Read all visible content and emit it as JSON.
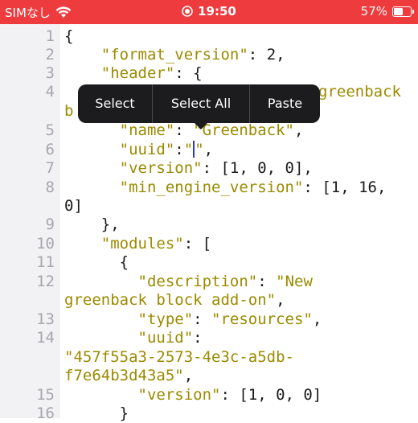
{
  "status_bar": {
    "carrier": "SIMなし",
    "time": "19:50",
    "battery": "57%",
    "battery_level": 0.57
  },
  "context_menu": {
    "items": [
      "Select",
      "Select All",
      "Paste"
    ]
  },
  "editor": {
    "line_numbers": [
      "1",
      "2",
      "3",
      "4",
      "5",
      "6",
      "7",
      "8",
      "9",
      "10",
      "11",
      "12",
      "13",
      "14",
      "15",
      "16"
    ],
    "code": {
      "l1": "{",
      "l2_key": "\"format_version\"",
      "l2_val": "2,",
      "l3_key": "\"header\"",
      "l3_rest": "{",
      "l4_visible": "greenback",
      "l4_wrap": "b",
      "l5_key": "\"name\"",
      "l5_val": "\"Greenback\"",
      "l6_key": "\"uuid\"",
      "l6_open": "\"",
      "l6_close": "\"",
      "l7_key": "\"version\"",
      "l7_val": "[1, 0, 0],",
      "l8_key": "\"min_engine_version\"",
      "l8_val": "[1, 16,",
      "l8_wrap": "0]",
      "l9": "},",
      "l10_key": "\"modules\"",
      "l10_val": "[",
      "l11": "{",
      "l12_key": "\"description\"",
      "l12_val": "\"New",
      "l12_wrap": "greenback block add-on\"",
      "l13_key": "\"type\"",
      "l13_val": "\"resources\"",
      "l14_key": "\"uuid\"",
      "l14_val": "\"457f55a3-2573-4e3c-a5db-",
      "l14_wrap": "f7e64b3d43a5\"",
      "l15_key": "\"version\"",
      "l15_val": "[1, 0, 0]",
      "l16": "}"
    }
  }
}
